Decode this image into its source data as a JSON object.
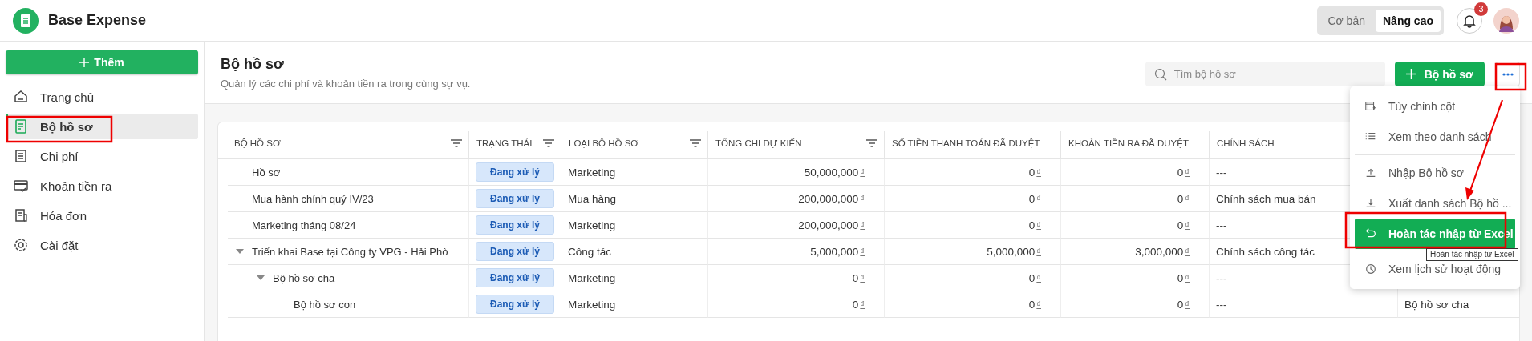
{
  "app": {
    "name": "Base Expense"
  },
  "mode_toggle": [
    {
      "label": "Cơ bản",
      "selected": false
    },
    {
      "label": "Nâng cao",
      "selected": true
    }
  ],
  "notifications": {
    "badge": "3"
  },
  "sidebar": {
    "add_button": "Thêm",
    "items": [
      {
        "label": "Trang chủ",
        "selected": false
      },
      {
        "label": "Bộ hồ sơ",
        "selected": true
      },
      {
        "label": "Chi phí",
        "selected": false
      },
      {
        "label": "Khoản tiền ra",
        "selected": false
      },
      {
        "label": "Hóa đơn",
        "selected": false
      },
      {
        "label": "Cài đặt",
        "selected": false
      }
    ]
  },
  "page": {
    "title": "Bộ hồ sơ",
    "subtitle": "Quản lý các chi phí và khoản tiền ra trong cùng sự vụ.",
    "search": {
      "placeholder": "Tìm bộ hồ sơ"
    },
    "create_button": "Bộ hồ sơ"
  },
  "table": {
    "columns": [
      {
        "label": "BỘ HỒ SƠ",
        "filterable": true
      },
      {
        "label": "TRẠNG THÁI",
        "filterable": true
      },
      {
        "label": "LOẠI BỘ HỒ SƠ",
        "filterable": true
      },
      {
        "label": "TỔNG CHI DỰ KIẾN",
        "filterable": true
      },
      {
        "label": "SỐ TIỀN THANH TOÁN ĐÃ DUYỆT",
        "filterable": false
      },
      {
        "label": "KHOẢN TIỀN RA ĐÃ DUYỆT",
        "filterable": false
      },
      {
        "label": "CHÍNH SÁCH",
        "filterable": false
      }
    ],
    "rows": [
      {
        "name": "Hồ sơ",
        "status": "Đang xử lý",
        "type": "Marketing",
        "total": {
          "amount": "50,000,000",
          "currency": "₫"
        },
        "paid": {
          "amount": "0",
          "currency": "₫"
        },
        "outflow": {
          "amount": "0",
          "currency": "₫"
        },
        "policy": "---"
      },
      {
        "name": "Mua hành chính quý IV/23",
        "status": "Đang xử lý",
        "type": "Mua hàng",
        "total": {
          "amount": "200,000,000",
          "currency": "₫"
        },
        "paid": {
          "amount": "0",
          "currency": "₫"
        },
        "outflow": {
          "amount": "0",
          "currency": "₫"
        },
        "policy": "Chính sách mua bán"
      },
      {
        "name": "Marketing tháng 08/24",
        "status": "Đang xử lý",
        "type": "Marketing",
        "total": {
          "amount": "200,000,000",
          "currency": "₫"
        },
        "paid": {
          "amount": "0",
          "currency": "₫"
        },
        "outflow": {
          "amount": "0",
          "currency": "₫"
        },
        "policy": "---"
      },
      {
        "name": "Triển khai Base tại Công ty VPG - Hải Phò",
        "status": "Đang xử lý",
        "type": "Công tác",
        "total": {
          "amount": "5,000,000",
          "currency": "₫"
        },
        "paid": {
          "amount": "5,000,000",
          "currency": "₫"
        },
        "outflow": {
          "amount": "3,000,000",
          "currency": "₫"
        },
        "policy": "Chính sách công tác",
        "expanded": true,
        "children": [
          {
            "name": "Bộ hồ sơ cha",
            "status": "Đang xử lý",
            "type": "Marketing",
            "total": {
              "amount": "0",
              "currency": "₫"
            },
            "paid": {
              "amount": "0",
              "currency": "₫"
            },
            "outflow": {
              "amount": "0",
              "currency": "₫"
            },
            "policy": "---",
            "expanded": true,
            "children": [
              {
                "name": "Bộ hồ sơ con",
                "status": "Đang xử lý",
                "type": "Marketing",
                "total": {
                  "amount": "0",
                  "currency": "₫"
                },
                "paid": {
                  "amount": "0",
                  "currency": "₫"
                },
                "outflow": {
                  "amount": "0",
                  "currency": "₫"
                },
                "policy": "---",
                "parent": "Bộ hồ sơ cha"
              }
            ]
          }
        ]
      }
    ]
  },
  "menu": {
    "groups": [
      [
        {
          "label": "Tùy chỉnh cột",
          "selected": false
        },
        {
          "label": "Xem theo danh sách",
          "selected": false
        }
      ],
      [
        {
          "label": "Nhập Bộ hồ sơ",
          "selected": false
        },
        {
          "label": "Xuất danh sách Bộ hồ ...",
          "selected": false
        },
        {
          "label": "Hoàn tác nhập từ Excel",
          "selected": true
        },
        {
          "label": "Xem lịch sử hoạt động",
          "selected": false
        }
      ]
    ]
  },
  "tooltip": "Hoàn tác nhập từ Excel"
}
